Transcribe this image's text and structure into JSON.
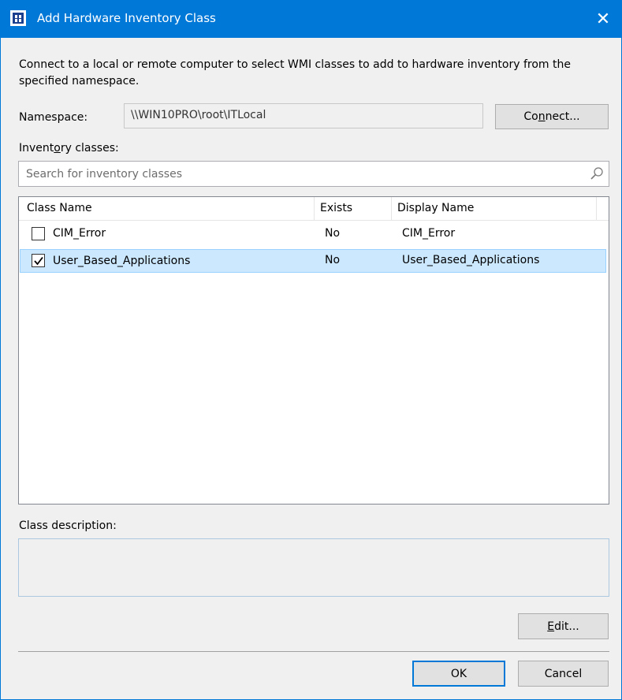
{
  "window": {
    "title": "Add Hardware Inventory Class",
    "close_glyph": "✕"
  },
  "intro_text": "Connect to a local or remote computer to select WMI classes to add to hardware inventory from the specified namespace.",
  "namespace": {
    "label": "Namespace:",
    "value": "\\\\WIN10PRO\\root\\ITLocal",
    "connect_pre": "Co",
    "connect_mnemonic": "n",
    "connect_post": "nect..."
  },
  "inventory": {
    "label_pre": "Invent",
    "label_mnemonic": "o",
    "label_post": "ry classes:",
    "search_placeholder": "Search for inventory classes"
  },
  "table": {
    "columns": [
      "Class Name",
      "Exists",
      "Display Name"
    ],
    "rows": [
      {
        "class_name": "CIM_Error",
        "exists": "No",
        "display_name": "CIM_Error",
        "checked": false,
        "selected": false
      },
      {
        "class_name": "User_Based_Applications",
        "exists": "No",
        "display_name": "User_Based_Applications",
        "checked": true,
        "selected": true
      }
    ]
  },
  "description": {
    "label": "Class description:",
    "text": ""
  },
  "buttons": {
    "edit_mnemonic": "E",
    "edit_post": "dit...",
    "ok": "OK",
    "cancel": "Cancel"
  },
  "colors": {
    "accent": "#0078d7",
    "selection": "#cce8ff"
  },
  "icons": {
    "app": "hardware-inventory-icon",
    "search": "search-icon",
    "close": "close-icon",
    "check": "checkmark-icon"
  }
}
